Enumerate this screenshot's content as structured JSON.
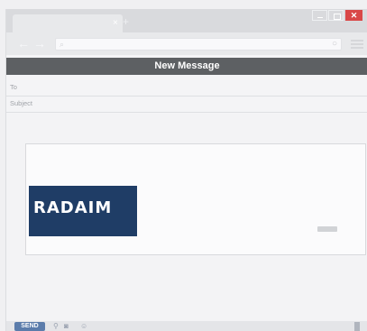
{
  "window": {
    "tab_close": "×",
    "new_tab": "+",
    "close_glyph": "✕"
  },
  "nav": {
    "back_glyph": "←",
    "forward_glyph": "→",
    "search_glyph": "⌕",
    "reload_glyph": "○"
  },
  "compose": {
    "title": "New Message",
    "to_label": "To",
    "subject_label": "Subject"
  },
  "card": {
    "banner_logo": "RADAIM",
    "banner_subtitle": "",
    "title": "",
    "body_text": ""
  },
  "toolbar": {
    "send_label": "SEND",
    "attach_icon": "paperclip-icon",
    "camera_icon": "camera-icon",
    "emoji_icon": "emoji-icon",
    "trash_icon": "trash-icon"
  },
  "colors": {
    "header_bg": "#5d6063",
    "send_bg": "#5b7cab",
    "close_bg": "#d94747",
    "banner_bg": "#1f3d66"
  }
}
